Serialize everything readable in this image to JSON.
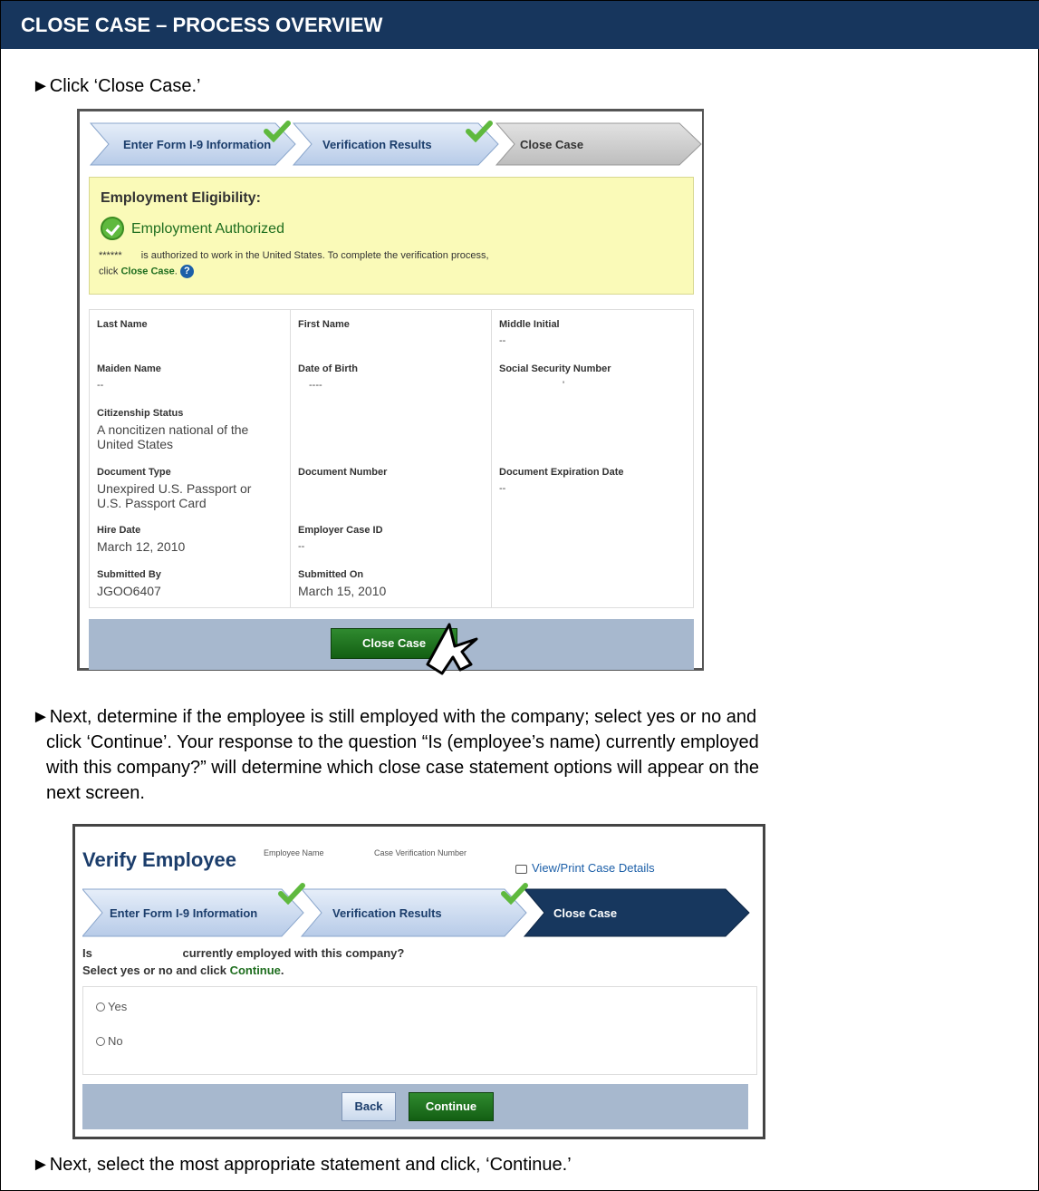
{
  "header": {
    "title": "CLOSE CASE – PROCESS OVERVIEW"
  },
  "instructions": [
    "►Click ‘Close Case.’",
    "►Next, determine if the employee is still employed with the company; select yes or no and",
    "click ‘Continue’. Your response to the question “Is (employee’s name) currently employed",
    "with this company?” will determine which close case statement options will appear on the",
    "next screen.",
    "►Next, select the most appropriate statement and click, ‘Continue.’"
  ],
  "shot1": {
    "steps": [
      "Enter Form I-9 Information",
      "Verification Results",
      "Close Case"
    ],
    "eligibility": {
      "title": "Employment Eligibility:",
      "status": "Employment Authorized",
      "name_mask": "******",
      "line1": "is authorized to work in the United States. To complete the verification process,",
      "line2_pre": "click",
      "line2_link": "Close Case",
      "line2_post": ".",
      "help": "?"
    },
    "fields": {
      "last_name_label": "Last Name",
      "first_name_label": "First Name",
      "middle_initial_label": "Middle Initial",
      "middle_initial_value": "--",
      "maiden_name_label": "Maiden Name",
      "maiden_name_value": "--",
      "dob_label": "Date of Birth",
      "dob_value": "----",
      "ssn_label": "Social Security Number",
      "ssn_value": "'",
      "citizenship_label": "Citizenship Status",
      "citizenship_value": "A noncitizen national of the United States",
      "doc_type_label": "Document Type",
      "doc_type_value": "Unexpired U.S. Passport or U.S. Passport Card",
      "doc_number_label": "Document Number",
      "doc_exp_label": "Document Expiration Date",
      "doc_exp_value": "--",
      "hire_date_label": "Hire Date",
      "hire_date_value": "March 12, 2010",
      "employer_case_label": "Employer Case ID",
      "employer_case_value": "--",
      "submitted_by_label": "Submitted By",
      "submitted_by_value": "JGOO6407",
      "submitted_on_label": "Submitted On",
      "submitted_on_value": "March 15, 2010"
    },
    "close_button": "Close Case"
  },
  "shot2": {
    "title": "Verify Employee",
    "employee_name_label": "Employee Name",
    "case_number_label": "Case Verification Number",
    "print_link": "View/Print Case Details",
    "steps": [
      "Enter Form I-9 Information",
      "Verification Results",
      "Close Case"
    ],
    "question_pre": "Is",
    "question_post": "currently employed with this company?",
    "instruction_pre": "Select yes or no and click",
    "instruction_link": "Continue",
    "instruction_post": ".",
    "options": [
      "Yes",
      "No"
    ],
    "back_button": "Back",
    "continue_button": "Continue"
  },
  "colors": {
    "header_bg": "#17365d",
    "accent_green": "#1f6e1f",
    "step_blue_light": "#c6d6ee",
    "step_active_dark": "#17375e",
    "eligibility_bg": "#fafab8",
    "footer_bg": "#a7b8ce"
  }
}
